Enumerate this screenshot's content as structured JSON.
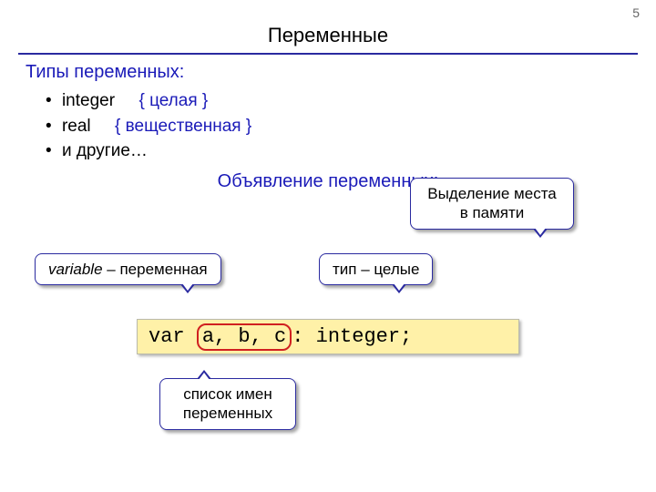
{
  "page_number": "5",
  "title": "Переменные",
  "types_heading": "Типы переменных:",
  "types": [
    {
      "name": "integer",
      "comment": "{ целая }"
    },
    {
      "name": "real",
      "comment": "{ вещественная }"
    },
    {
      "name": "и другие…",
      "comment": ""
    }
  ],
  "decl_heading": "Объявление переменных:",
  "callouts": {
    "memory": "Выделение места в памяти",
    "variable_word": "variable",
    "variable_rest": " – переменная",
    "type_int": "тип – целые",
    "var_list": "список имен переменных"
  },
  "code": {
    "kw_var": "var ",
    "vars": "a, b, c",
    "tail": ": integer;"
  }
}
